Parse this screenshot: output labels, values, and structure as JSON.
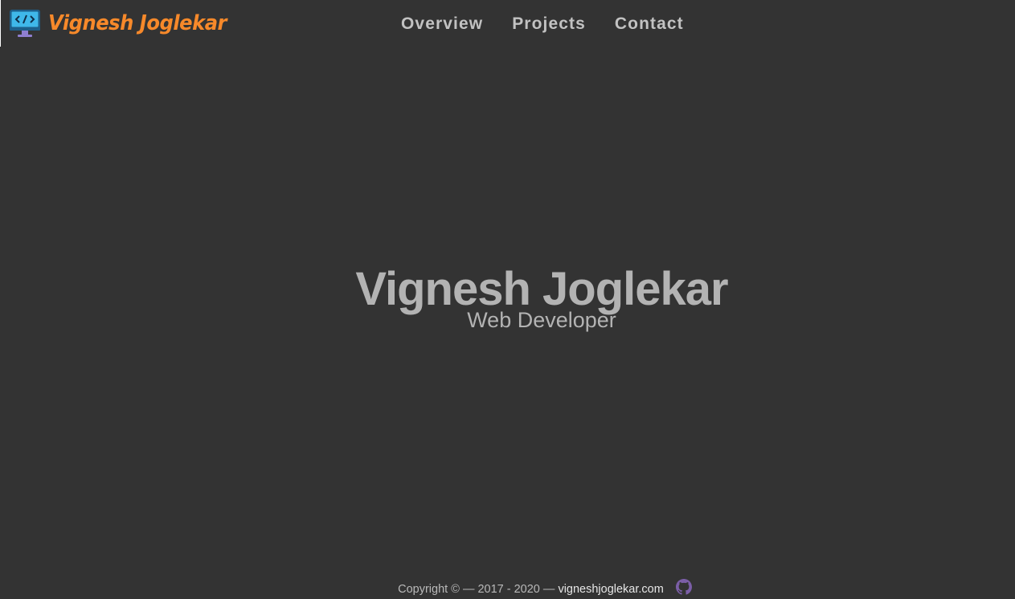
{
  "header": {
    "brand_name": "Vignesh Joglekar",
    "brand_icon": "code-monitor-icon"
  },
  "nav": {
    "items": [
      {
        "label": "Overview"
      },
      {
        "label": "Projects"
      },
      {
        "label": "Contact"
      }
    ]
  },
  "hero": {
    "name": "Vignesh Joglekar",
    "role": "Web Developer"
  },
  "footer": {
    "copyright": "Copyright © ",
    "years": " — 2017 - 2020 — ",
    "site_link": "vigneshjoglekar.com",
    "github_icon": "github-icon"
  },
  "colors": {
    "background": "#333333",
    "brand_orange": "#f7892a",
    "nav_text": "#c2c2c2",
    "hero_text": "#b3b3b3",
    "github_purple": "#7b5ea7"
  }
}
